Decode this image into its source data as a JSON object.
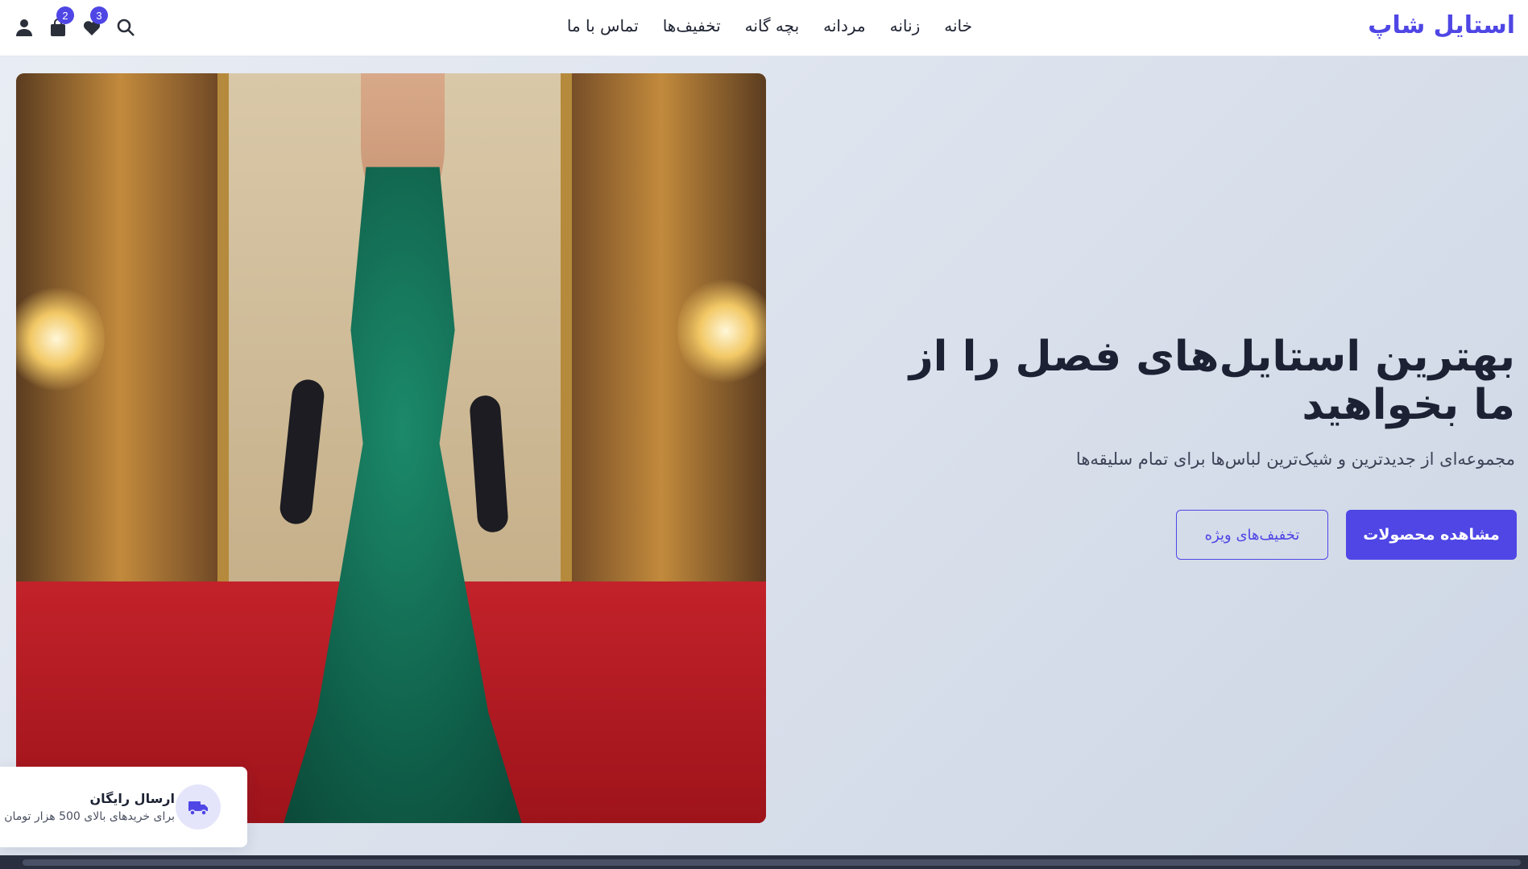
{
  "header": {
    "logo": "استایل شاپ",
    "nav": [
      "خانه",
      "زنانه",
      "مردانه",
      "بچه گانه",
      "تخفیف‌ها",
      "تماس با ما"
    ],
    "wishlist_count": "3",
    "cart_count": "2",
    "icons": [
      "search-icon",
      "heart-icon",
      "bag-icon",
      "user-icon"
    ]
  },
  "hero": {
    "title": "بهترین استایل‌های فصل را از ما بخواهید",
    "subtitle": "مجموعه‌ای از جدیدترین و شیک‌ترین لباس‌ها برای تمام سلیقه‌ها",
    "primary_button": "مشاهده محصولات",
    "secondary_button": "تخفیف‌های ویژه"
  },
  "shipping": {
    "title": "ارسال رایگان",
    "desc": "برای خریدهای بالای 500 هزار تومان",
    "icon": "truck-icon"
  },
  "colors": {
    "accent": "#4f46e5",
    "text": "#1c2233"
  }
}
